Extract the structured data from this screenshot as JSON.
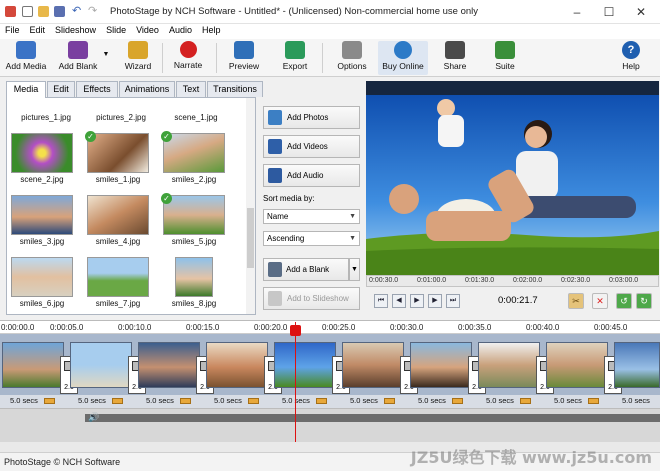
{
  "window": {
    "title": "PhotoStage by NCH Software - Untitled* - (Unlicensed) Non-commercial home use only",
    "minimize": "–",
    "maximize": "☐",
    "close": "✕"
  },
  "menu": [
    "File",
    "Edit",
    "Slideshow",
    "Slide",
    "Video",
    "Audio",
    "Help"
  ],
  "toolbar": {
    "add_media": "Add Media",
    "add_blank": "Add Blank",
    "wizard": "Wizard",
    "narrate": "Narrate",
    "preview": "Preview",
    "export": "Export",
    "options": "Options",
    "buy_online": "Buy Online",
    "share": "Share",
    "suite": "Suite",
    "help": "Help"
  },
  "tabs": [
    "Media",
    "Edit",
    "Effects",
    "Animations",
    "Text",
    "Transitions"
  ],
  "media": [
    {
      "name": "pictures_1.jpg",
      "checked": false
    },
    {
      "name": "pictures_2.jpg",
      "checked": false
    },
    {
      "name": "scene_1.jpg",
      "checked": false
    },
    {
      "name": "scene_2.jpg",
      "checked": false
    },
    {
      "name": "smiles_1.jpg",
      "checked": true
    },
    {
      "name": "smiles_2.jpg",
      "checked": true
    },
    {
      "name": "smiles_3.jpg",
      "checked": false
    },
    {
      "name": "smiles_4.jpg",
      "checked": false
    },
    {
      "name": "smiles_5.jpg",
      "checked": true
    },
    {
      "name": "smiles_6.jpg",
      "checked": false
    },
    {
      "name": "smiles_7.jpg",
      "checked": false
    },
    {
      "name": "smiles_8.jpg",
      "checked": false
    }
  ],
  "side": {
    "add_photos": "Add Photos",
    "add_videos": "Add Videos",
    "add_audio": "Add Audio",
    "sort_label": "Sort media by:",
    "sort_by": "Name",
    "sort_order": "Ascending",
    "add_blank_slide": "Add a Blank Slide",
    "add_to_slideshow": "Add to Slideshow"
  },
  "preview": {
    "scrub_ticks": [
      "0:00:30.0",
      "0:01:00.0",
      "0:01:30.0",
      "0:02:00.0",
      "0:02:30.0",
      "0:03:00.0"
    ],
    "current_time": "0:00:21.7"
  },
  "timeline": {
    "ruler": [
      "0:00:00.0",
      "0:00:05.0",
      "0:00:10.0",
      "0:00:15.0",
      "0:00:20.0",
      "0:00:25.0",
      "0:00:30.0",
      "0:00:35.0",
      "0:00:40.0",
      "0:00:45.0"
    ],
    "clip_duration": "5.0 secs",
    "transition_duration": "2.0"
  },
  "status": "PhotoStage © NCH Software",
  "watermark": "JZ5U绿色下载 www.jz5u.com",
  "colors": {
    "accent": "#2b5797",
    "playhead": "#dd1111",
    "check": "#3fa23a"
  }
}
